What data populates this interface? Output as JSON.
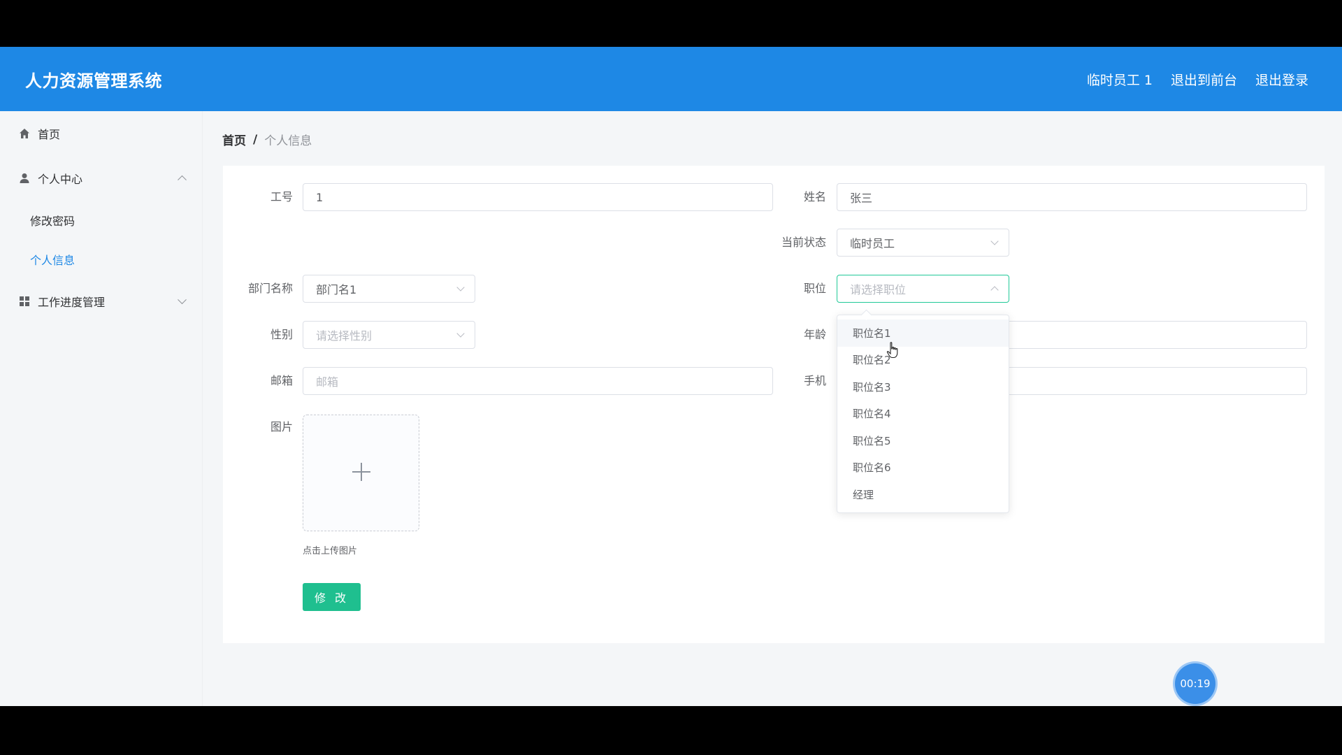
{
  "header": {
    "title": "人力资源管理系统",
    "user": "临时员工 1",
    "back_to_front": "退出到前台",
    "logout": "退出登录"
  },
  "sidebar": {
    "items": [
      {
        "label": "首页",
        "icon": "home-icon"
      },
      {
        "label": "个人中心",
        "icon": "user-icon",
        "expanded": true,
        "children": [
          {
            "label": "修改密码"
          },
          {
            "label": "个人信息",
            "active": true
          }
        ]
      },
      {
        "label": "工作进度管理",
        "icon": "grid-icon",
        "expanded": false
      }
    ]
  },
  "breadcrumb": {
    "home": "首页",
    "sep": "/",
    "current": "个人信息"
  },
  "form": {
    "job_no": {
      "label": "工号",
      "value": "1"
    },
    "name": {
      "label": "姓名",
      "value": "张三"
    },
    "status": {
      "label": "当前状态",
      "value": "临时员工"
    },
    "department": {
      "label": "部门名称",
      "value": "部门名1"
    },
    "position": {
      "label": "职位",
      "placeholder": "请选择职位"
    },
    "gender": {
      "label": "性别",
      "placeholder": "请选择性别"
    },
    "age": {
      "label": "年龄",
      "value": ""
    },
    "email": {
      "label": "邮箱",
      "placeholder": "邮箱"
    },
    "phone": {
      "label": "手机",
      "value": ""
    },
    "photo": {
      "label": "图片",
      "hint": "点击上传图片"
    },
    "submit": "修 改"
  },
  "position_dropdown": {
    "options": [
      "职位名1",
      "职位名2",
      "职位名3",
      "职位名4",
      "职位名5",
      "职位名6",
      "经理"
    ],
    "hovered_index": 0
  },
  "timer": "00:19",
  "colors": {
    "primary": "#1e88e5",
    "accent": "#1fbf8f",
    "focus": "#20c997"
  }
}
